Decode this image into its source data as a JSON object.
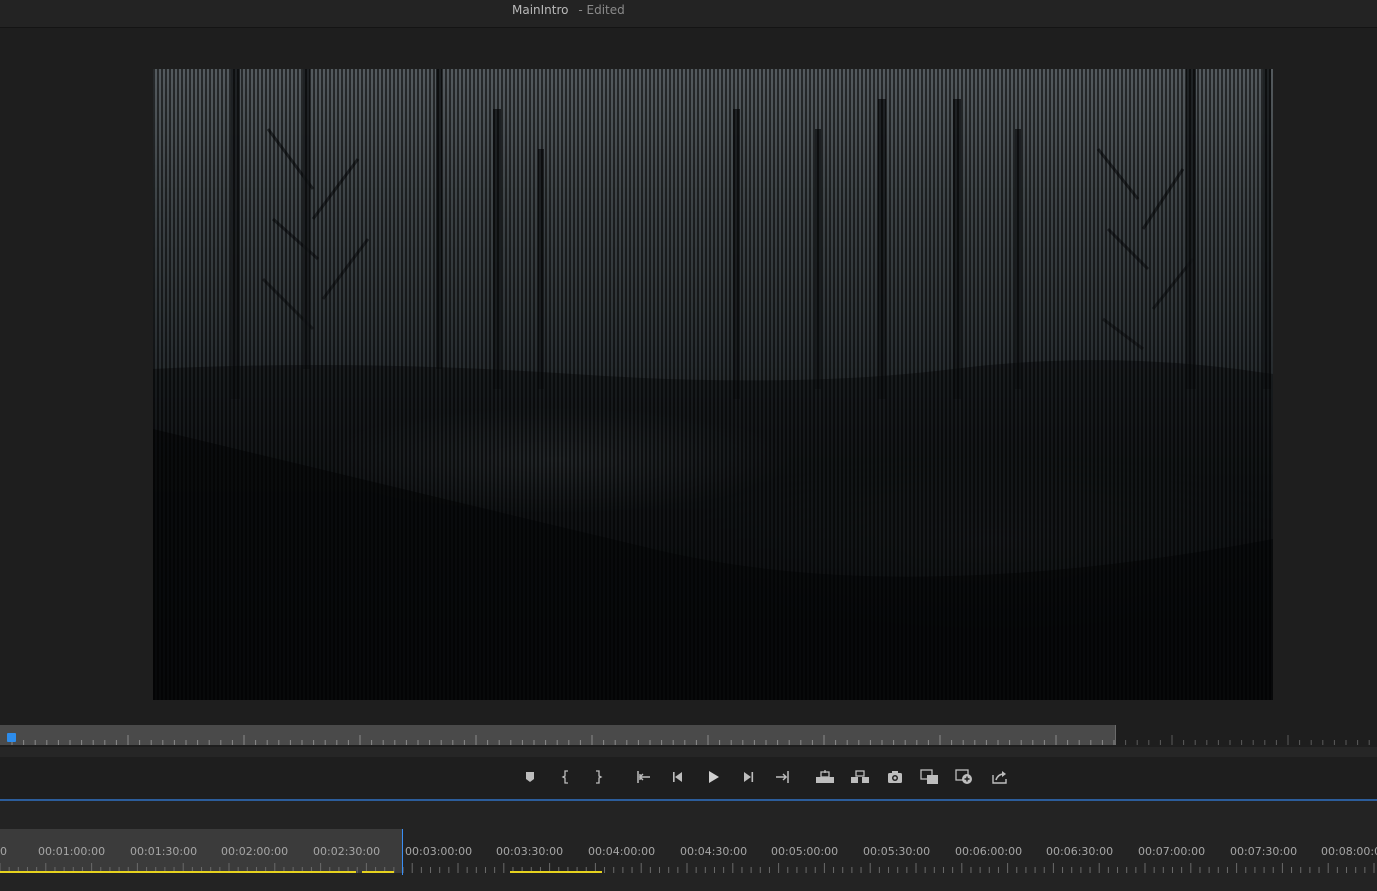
{
  "sequence": {
    "name": "MainIntro",
    "status": "- Edited"
  },
  "program_monitor": {
    "content": "dark misty forest night scene"
  },
  "transport_controls": [
    {
      "id": "add-marker",
      "icon": "marker-icon"
    },
    {
      "id": "mark-in",
      "icon": "mark-in-icon"
    },
    {
      "id": "mark-out",
      "icon": "mark-out-icon"
    },
    {
      "id": "go-to-in",
      "icon": "go-to-in-icon"
    },
    {
      "id": "step-back",
      "icon": "step-back-icon"
    },
    {
      "id": "play",
      "icon": "play-icon"
    },
    {
      "id": "step-forward",
      "icon": "step-forward-icon"
    },
    {
      "id": "go-to-out",
      "icon": "go-to-out-icon"
    },
    {
      "id": "lift",
      "icon": "lift-icon"
    },
    {
      "id": "extract",
      "icon": "extract-icon"
    },
    {
      "id": "export-frame",
      "icon": "camera-icon"
    },
    {
      "id": "comparison-view",
      "icon": "comparison-view-icon"
    },
    {
      "id": "toggle-proxies",
      "icon": "toggle-proxies-icon"
    },
    {
      "id": "share",
      "icon": "share-icon"
    }
  ],
  "timeline": {
    "timecodes": [
      "00:01:00:00",
      "00:01:30:00",
      "00:02:00:00",
      "00:02:30:00",
      "00:03:00:00",
      "00:03:30:00",
      "00:04:00:00",
      "00:04:30:00",
      "00:05:00:00",
      "00:05:30:00",
      "00:06:00:00",
      "00:06:30:00",
      "00:07:00:00",
      "00:07:30:00",
      "00:08:00:00"
    ],
    "first_partial_label": "0",
    "work_area_marker_color": "#e6d21e",
    "playhead_color": "#3a8ef5"
  },
  "colors": {
    "panel_bg": "#1e1e1e",
    "accent": "#2d8ceb",
    "panel_divider": "#2c5d9b"
  }
}
